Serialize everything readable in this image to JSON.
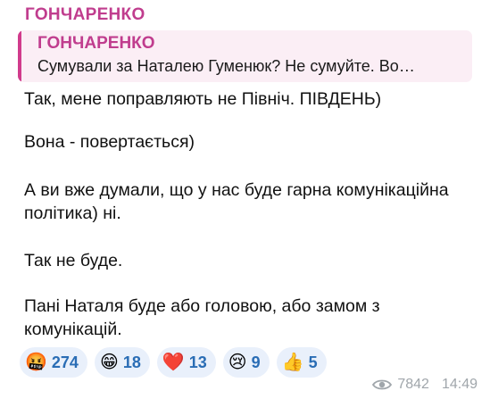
{
  "message": {
    "sender": "ГОНЧАРЕНКО",
    "reply": {
      "author": "ГОНЧАРЕНКО",
      "text": "Сумували за Наталею Гуменюк?   Не сумуйте.   Во…"
    },
    "paragraphs": [
      "Так, мене поправляють не Північ. ПІВДЕНЬ)",
      "Вона - повертається)",
      "А ви вже думали, що у нас буде гарна комунікаційна",
      "політика) ні.",
      "Так не буде.",
      "Пані Наталя буде або головою, або замом з",
      "комунікацій."
    ],
    "reactions": [
      {
        "emoji": "🤬",
        "icon": "angry-face-icon",
        "count": "274"
      },
      {
        "emoji": "😁",
        "icon": "grin-face-icon",
        "count": "18"
      },
      {
        "emoji": "❤️",
        "icon": "heart-icon",
        "count": "13"
      },
      {
        "emoji": "😢",
        "icon": "crying-face-icon",
        "count": "9"
      },
      {
        "emoji": "👍",
        "icon": "thumbs-up-icon",
        "count": "5"
      }
    ],
    "views": "7842",
    "time": "14:49"
  }
}
